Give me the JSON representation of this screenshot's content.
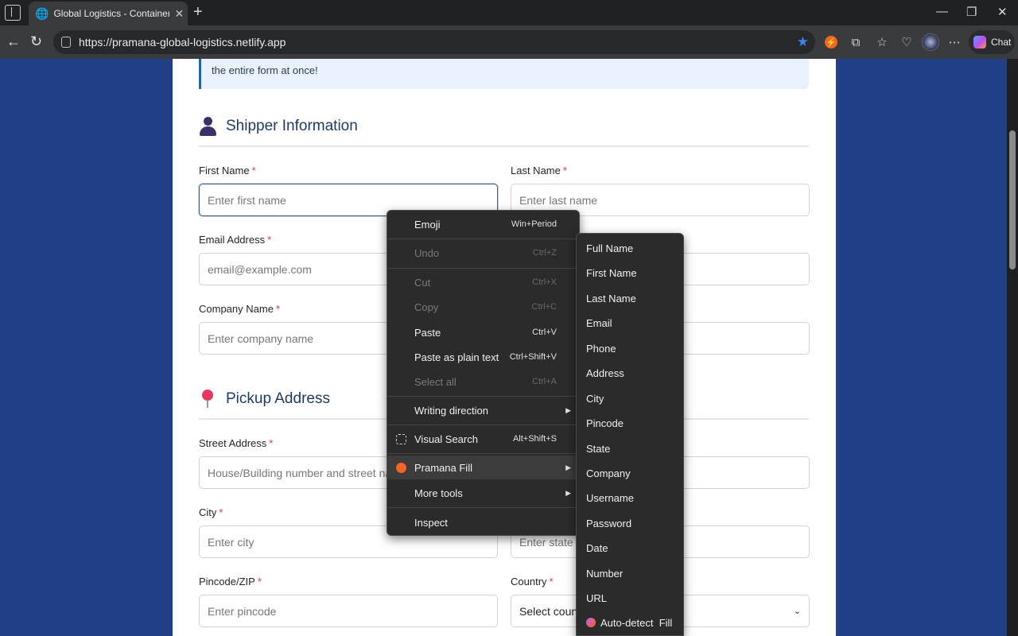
{
  "browser": {
    "tab_title": "Global Logistics - Container Shipp",
    "tab_close": "✕",
    "new_tab": "+",
    "url": "https://pramana-global-logistics.netlify.app",
    "chat_label": "Chat",
    "win_minimize": "—",
    "win_restore": "❐",
    "win_close": "✕"
  },
  "page": {
    "notice_text": "the entire form at once!",
    "shipper_section": {
      "title": "Shipper Information",
      "first_name_label": "First Name",
      "first_name_placeholder": "Enter first name",
      "last_name_label": "Last Name",
      "last_name_placeholder": "Enter last name",
      "email_label": "Email Address",
      "email_placeholder": "email@example.com",
      "company_label": "Company Name",
      "company_placeholder": "Enter company name"
    },
    "pickup_section": {
      "title": "Pickup Address",
      "street_label": "Street Address",
      "street_placeholder": "House/Building number and street name",
      "city_label": "City",
      "city_placeholder": "Enter city",
      "state_placeholder": "Enter state",
      "pincode_label": "Pincode/ZIP",
      "pincode_placeholder": "Enter pincode",
      "country_label": "Country",
      "country_value": "Select countr"
    },
    "required_mark": "*"
  },
  "context_menu": {
    "items": [
      {
        "label": "Emoji",
        "shortcut": "Win+Period",
        "enabled": true
      },
      {
        "label": "Undo",
        "shortcut": "Ctrl+Z",
        "enabled": false
      },
      {
        "label": "Cut",
        "shortcut": "Ctrl+X",
        "enabled": false
      },
      {
        "label": "Copy",
        "shortcut": "Ctrl+C",
        "enabled": false
      },
      {
        "label": "Paste",
        "shortcut": "Ctrl+V",
        "enabled": true
      },
      {
        "label": "Paste as plain text",
        "shortcut": "Ctrl+Shift+V",
        "enabled": true
      },
      {
        "label": "Select all",
        "shortcut": "Ctrl+A",
        "enabled": false
      },
      {
        "label": "Writing direction",
        "shortcut": "",
        "enabled": true
      },
      {
        "label": "Visual Search",
        "shortcut": "Alt+Shift+S",
        "enabled": true
      },
      {
        "label": "Pramana Fill",
        "shortcut": "",
        "enabled": true
      },
      {
        "label": "More tools",
        "shortcut": "",
        "enabled": true
      },
      {
        "label": "Inspect",
        "shortcut": "",
        "enabled": true
      }
    ]
  },
  "submenu": {
    "items": [
      "Full Name",
      "First Name",
      "Last Name",
      "Email",
      "Phone",
      "Address",
      "City",
      "Pincode",
      "State",
      "Company",
      "Username",
      "Password",
      "Date",
      "Number",
      "URL",
      "Auto-detect  Fill"
    ]
  },
  "colors": {
    "accent": "#3b82f6",
    "page_bg": "#213f87",
    "required": "#dc3545",
    "pramana_orange": "#f26522"
  }
}
